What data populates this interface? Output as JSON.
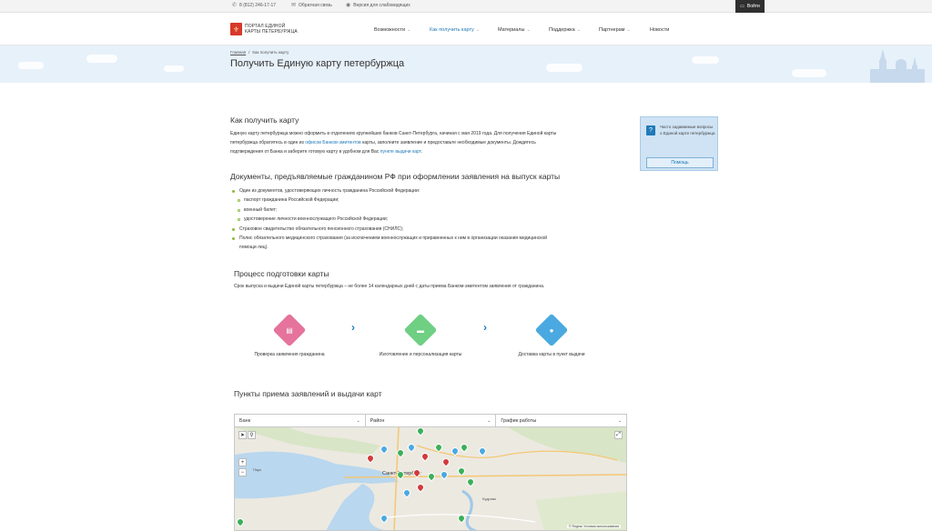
{
  "topbar": {
    "phone": "8 (812) 246-17-17",
    "feedback": "Обратная связь",
    "accessible": "Версия для слабовидящих",
    "login": "Войти"
  },
  "header": {
    "logo_line1": "ПОРТАЛ ЕДИНОЙ",
    "logo_line2": "КАРТЫ ПЕТЕРБУРЖЦА",
    "nav": [
      {
        "label": "Возможности",
        "dropdown": true,
        "active": false
      },
      {
        "label": "Как получить карту",
        "dropdown": true,
        "active": true
      },
      {
        "label": "Материалы",
        "dropdown": true,
        "active": false
      },
      {
        "label": "Поддержка",
        "dropdown": true,
        "active": false
      },
      {
        "label": "Партнерам",
        "dropdown": true,
        "active": false
      },
      {
        "label": "Новости",
        "dropdown": false,
        "active": false
      }
    ]
  },
  "breadcrumb": {
    "home": "Главная",
    "sep": "/",
    "current": "Как получить карту"
  },
  "page_title": "Получить Единую карту петербуржца",
  "section_how": {
    "title": "Как получить карту",
    "text_1": "Единую карту петербуржца можно оформить в отделениях крупнейших банков Санкт-Петербурга, начиная с мая 2019 года. Для получения Единой карты",
    "text_2a": "петербуржца обратитесь в один из ",
    "text_2_link": "офисов Банков-эмитентов",
    "text_2b": " карты, заполните заявление и предоставьте необходимые документы. Дождитесь",
    "text_3a": "подтверждения от Банка и заберите готовую карту в удобном для Вас ",
    "text_3_link": "пункте выдачи карт",
    "text_3b": "."
  },
  "help_box": {
    "text": "Часто задаваемые вопросы о Единой карте петербуржца",
    "button": "Помощь"
  },
  "section_docs": {
    "title": "Документы, предъявляемые гражданином РФ при оформлении заявления на выпуск карты",
    "items": [
      {
        "text": "Один из документов, удостоверяющих личность гражданина Российской Федерации:",
        "sub": false
      },
      {
        "text": "паспорт гражданина Российской Федерации;",
        "sub": true
      },
      {
        "text": "военный билет;",
        "sub": true
      },
      {
        "text": "удостоверение личности военнослужащего Российской Федерации;",
        "sub": true
      },
      {
        "text": "Страховое свидетельство обязательного пенсионного страхования (СНИЛС);",
        "sub": false
      },
      {
        "text": "Полис обязательного медицинского страхования (за исключением военнослужащих и приравненных к ним в организации оказания медицинской",
        "sub": false
      },
      {
        "text": "помощи лиц).",
        "sub": "cont"
      }
    ]
  },
  "section_process": {
    "title": "Процесс подготовки карты",
    "text": "Срок выпуска и выдачи Единой карты петербуржца – не более 14 календарных дней с даты приема Банком-эмитентом заявления от гражданина.",
    "steps": [
      {
        "label": "Проверка заявления гражданина",
        "color": "#e5739b",
        "icon": "clipboard-icon"
      },
      {
        "label": "Изготовление и персонализация карты",
        "color": "#6fcf83",
        "icon": "card-icon"
      },
      {
        "label": "Доставка карты в пункт выдачи",
        "color": "#4aa9e0",
        "icon": "location-pin-icon"
      }
    ]
  },
  "section_map": {
    "title": "Пункты приема заявлений и выдачи карт",
    "filters": [
      "Банк",
      "Район",
      "График работы"
    ],
    "place_labels": [
      "Санкт-Петербург",
      "Кудрово",
      "Парк"
    ],
    "credit": "© Яндекс Условия использования"
  }
}
